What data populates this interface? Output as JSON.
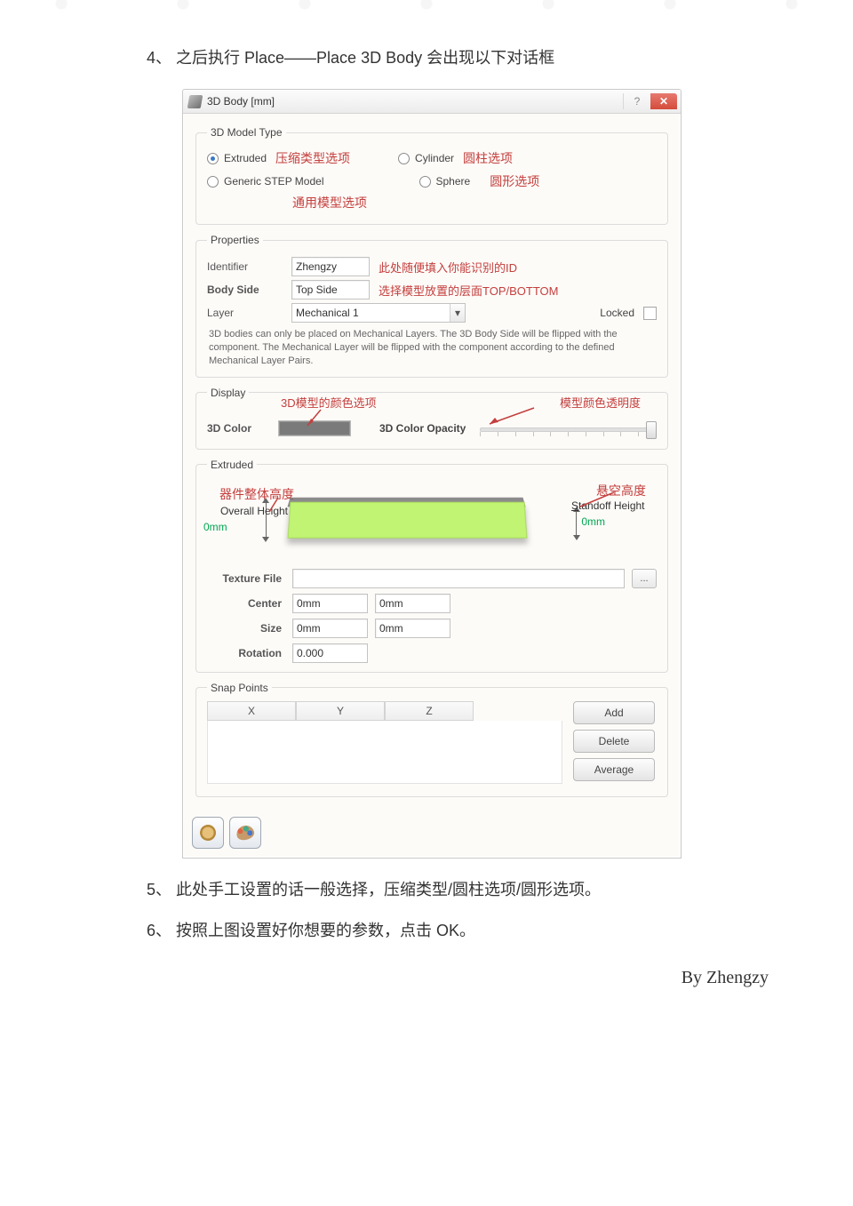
{
  "doc": {
    "step4": "4、 之后执行 Place——Place 3D Body 会出现以下对话框",
    "step5": "5、 此处手工设置的话一般选择，压缩类型/圆柱选项/圆形选项。",
    "step6": "6、 按照上图设置好你想要的参数，点击 OK。",
    "author": "By Zhengzy"
  },
  "window": {
    "title": "3D Body [mm]",
    "btn_help": "?",
    "btn_close": "✕"
  },
  "section_model_type": {
    "legend": "3D Model Type",
    "extruded": "Extruded",
    "cylinder": "Cylinder",
    "generic": "Generic STEP Model",
    "sphere": "Sphere",
    "anno_extruded": "压缩类型选项",
    "anno_cylinder": "圆柱选项",
    "anno_generic": "通用模型选项",
    "anno_sphere": "圆形选项"
  },
  "section_properties": {
    "legend": "Properties",
    "identifier_label": "Identifier",
    "identifier_value": "Zhengzy",
    "identifier_anno": "此处随便填入你能识别的ID",
    "bodyside_label": "Body Side",
    "bodyside_value": "Top Side",
    "bodyside_anno": "选择模型放置的层面TOP/BOTTOM",
    "layer_label": "Layer",
    "layer_value": "Mechanical 1",
    "locked_label": "Locked",
    "hint": "3D bodies can only be placed on Mechanical Layers. The 3D Body Side will be flipped with the component. The Mechanical Layer will be flipped with the component according to the defined Mechanical Layer Pairs."
  },
  "section_display": {
    "legend": "Display",
    "color_label": "3D Color",
    "opacity_label": "3D Color Opacity",
    "anno_coloropt": "3D模型的颜色选项",
    "anno_opacity": "模型颜色透明度"
  },
  "section_extruded": {
    "legend": "Extruded",
    "overall_label": "Overall Height",
    "overall_value": "0mm",
    "standoff_label": "Standoff Height",
    "standoff_underline": "S",
    "standoff_value": "0mm",
    "anno_overall": "器件整体高度",
    "anno_standoff": "悬空高度",
    "texture_label": "Texture File",
    "browse": "...",
    "center_label": "Center",
    "center_x": "0mm",
    "center_y": "0mm",
    "size_label": "Size",
    "size_x": "0mm",
    "size_y": "0mm",
    "rotation_label": "Rotation",
    "rotation_value": "0.000"
  },
  "section_snap": {
    "legend": "Snap Points",
    "x": "X",
    "y": "Y",
    "z": "Z",
    "btn_add": "Add",
    "btn_delete": "Delete",
    "btn_average": "Average"
  }
}
